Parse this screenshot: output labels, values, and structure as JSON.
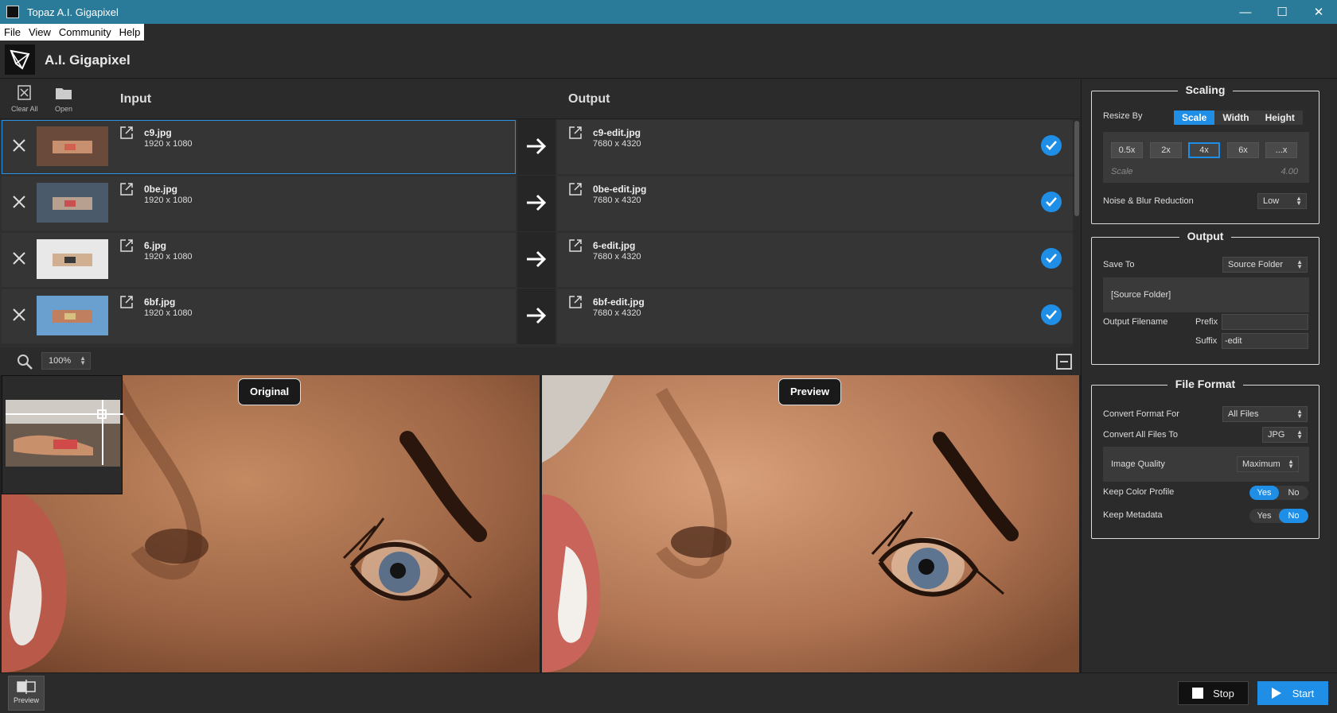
{
  "window": {
    "title": "Topaz A.I. Gigapixel",
    "minimize": "—",
    "maximize": "☐",
    "close": "✕"
  },
  "menu": [
    "File",
    "View",
    "Community",
    "Help"
  ],
  "app": {
    "title": "A.I. Gigapixel"
  },
  "toolbar": {
    "clear_all": "Clear All",
    "open": "Open"
  },
  "columns": {
    "input": "Input",
    "output": "Output"
  },
  "files": [
    {
      "in_name": "c9.jpg",
      "in_dim": "1920 x 1080",
      "out_name": "c9-edit.jpg",
      "out_dim": "7680 x 4320",
      "selected": true
    },
    {
      "in_name": "0be.jpg",
      "in_dim": "1920 x 1080",
      "out_name": "0be-edit.jpg",
      "out_dim": "7680 x 4320",
      "selected": false
    },
    {
      "in_name": "6.jpg",
      "in_dim": "1920 x 1080",
      "out_name": "6-edit.jpg",
      "out_dim": "7680 x 4320",
      "selected": false
    },
    {
      "in_name": "6bf.jpg",
      "in_dim": "1920 x 1080",
      "out_name": "6bf-edit.jpg",
      "out_dim": "7680 x 4320",
      "selected": false
    }
  ],
  "zoom": {
    "value": "100%"
  },
  "viewer": {
    "original_label": "Original",
    "preview_label": "Preview"
  },
  "bottom": {
    "preview": "Preview",
    "stop": "Stop",
    "start": "Start"
  },
  "scaling": {
    "title": "Scaling",
    "resize_by": "Resize By",
    "modes": [
      "Scale",
      "Width",
      "Height"
    ],
    "active_mode": "Scale",
    "factors": [
      "0.5x",
      "2x",
      "4x",
      "6x",
      "...x"
    ],
    "active_factor": "4x",
    "scale_label": "Scale",
    "scale_value": "4.00",
    "noise_label": "Noise & Blur Reduction",
    "noise_value": "Low"
  },
  "output": {
    "title": "Output",
    "save_to_label": "Save To",
    "save_to_value": "Source Folder",
    "folder_path": "[Source Folder]",
    "filename_label": "Output Filename",
    "prefix_label": "Prefix",
    "prefix_value": "",
    "suffix_label": "Suffix",
    "suffix_value": "-edit"
  },
  "file_format": {
    "title": "File Format",
    "convert_for_label": "Convert Format For",
    "convert_for_value": "All Files",
    "convert_to_label": "Convert All Files To",
    "convert_to_value": "JPG",
    "quality_label": "Image Quality",
    "quality_value": "Maximum",
    "color_profile_label": "Keep Color Profile",
    "metadata_label": "Keep Metadata",
    "yes": "Yes",
    "no": "No",
    "color_profile": "Yes",
    "metadata": "No"
  },
  "colors": {
    "accent": "#1e8ee6",
    "titlebar": "#2a7a99",
    "panel": "#2b2b2b"
  }
}
